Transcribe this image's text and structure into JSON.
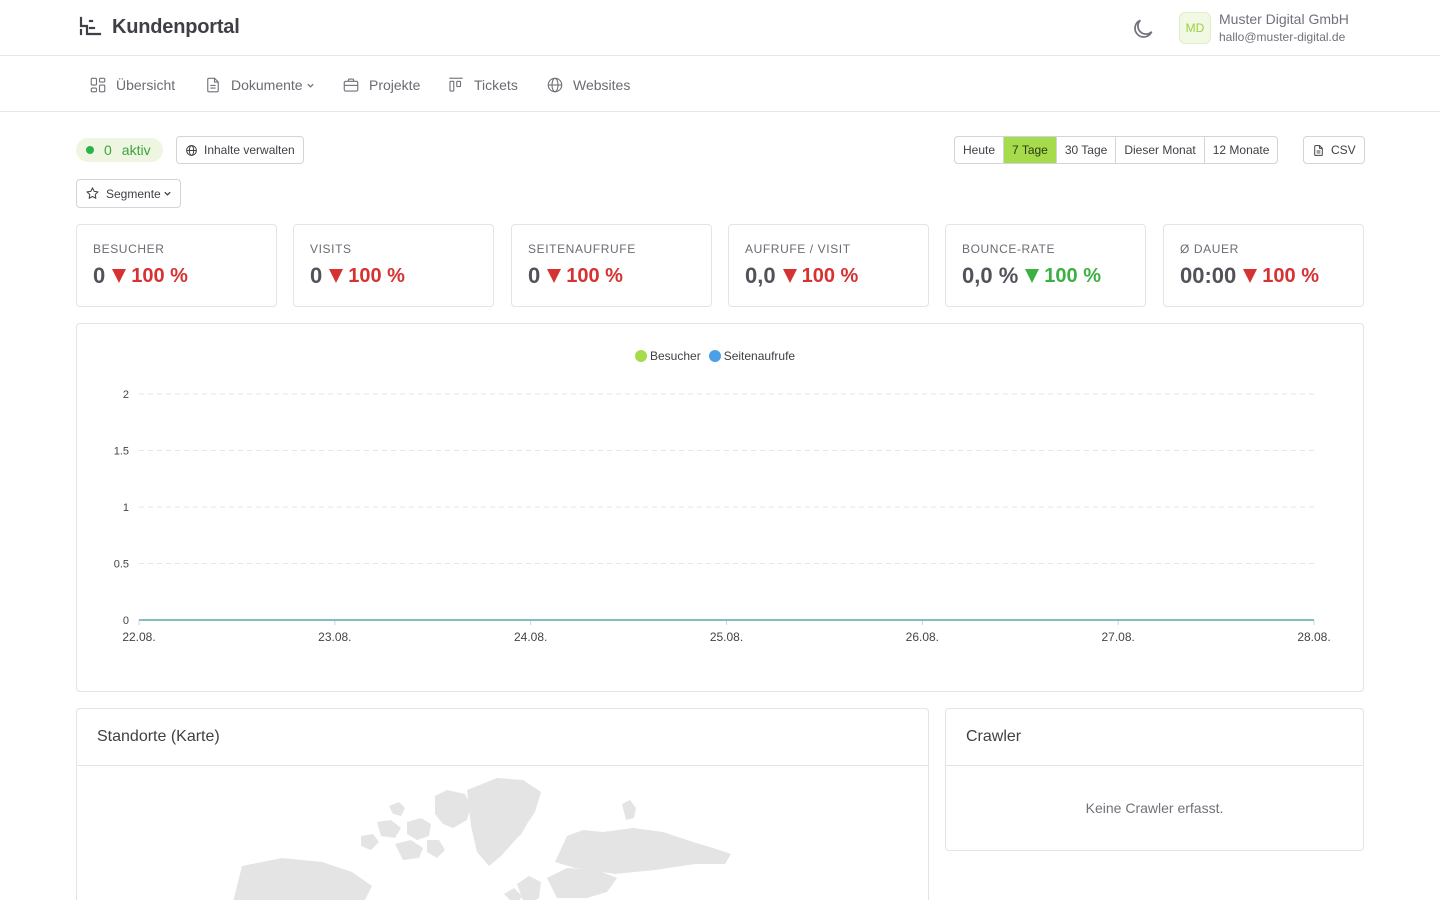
{
  "header": {
    "brand": "Kundenportal",
    "avatar_initials": "MD",
    "company": "Muster Digital GmbH",
    "email": "hallo@muster-digital.de",
    "theme_icon": "moon-icon"
  },
  "nav": {
    "items": [
      {
        "label": "Übersicht",
        "icon": "dashboard-icon"
      },
      {
        "label": "Dokumente",
        "icon": "document-icon",
        "dropdown": true
      },
      {
        "label": "Projekte",
        "icon": "briefcase-icon"
      },
      {
        "label": "Tickets",
        "icon": "kanban-icon"
      },
      {
        "label": "Websites",
        "icon": "globe-icon"
      }
    ]
  },
  "toolbar": {
    "active_count": "0",
    "active_label": "aktiv",
    "manage_label": "Inhalte verwalten",
    "segments_label": "Segmente",
    "ranges": [
      "Heute",
      "7 Tage",
      "30 Tage",
      "Dieser Monat",
      "12 Monate"
    ],
    "active_range": "7 Tage",
    "csv_label": "CSV"
  },
  "kpis": [
    {
      "label": "Besucher",
      "value": "0",
      "change": "100 %",
      "direction": "down",
      "sentiment": "bad"
    },
    {
      "label": "Visits",
      "value": "0",
      "change": "100 %",
      "direction": "down",
      "sentiment": "bad"
    },
    {
      "label": "Seitenaufrufe",
      "value": "0",
      "change": "100 %",
      "direction": "down",
      "sentiment": "bad"
    },
    {
      "label": "Aufrufe / Visit",
      "value": "0,0",
      "change": "100 %",
      "direction": "down",
      "sentiment": "bad"
    },
    {
      "label": "Bounce-Rate",
      "value": "0,0 %",
      "change": "100 %",
      "direction": "down",
      "sentiment": "good"
    },
    {
      "label": "Ø Dauer",
      "value": "00:00",
      "change": "100 %",
      "direction": "down",
      "sentiment": "bad"
    }
  ],
  "chart_data": {
    "type": "line",
    "title": "",
    "xlabel": "",
    "ylabel": "",
    "x": [
      "22.08.",
      "23.08.",
      "24.08.",
      "25.08.",
      "26.08.",
      "27.08.",
      "28.08."
    ],
    "series": [
      {
        "name": "Besucher",
        "values": [
          0,
          0,
          0,
          0,
          0,
          0,
          0
        ],
        "color": "#a6dc4c"
      },
      {
        "name": "Seitenaufrufe",
        "values": [
          0,
          0,
          0,
          0,
          0,
          0,
          0
        ],
        "color": "#4a9fe6"
      }
    ],
    "ylim": [
      0,
      2
    ],
    "yticks": [
      "0",
      "0.5",
      "1",
      "1.5",
      "2"
    ],
    "grid": true,
    "legend": "top-center"
  },
  "locations_card": {
    "title": "Standorte (Karte)"
  },
  "crawler_card": {
    "title": "Crawler",
    "empty_text": "Keine Crawler erfasst."
  },
  "colors": {
    "accent": "#a6dc4c",
    "negative": "#d63232",
    "positive": "#3cb043",
    "active_dot": "#2bb24c"
  }
}
